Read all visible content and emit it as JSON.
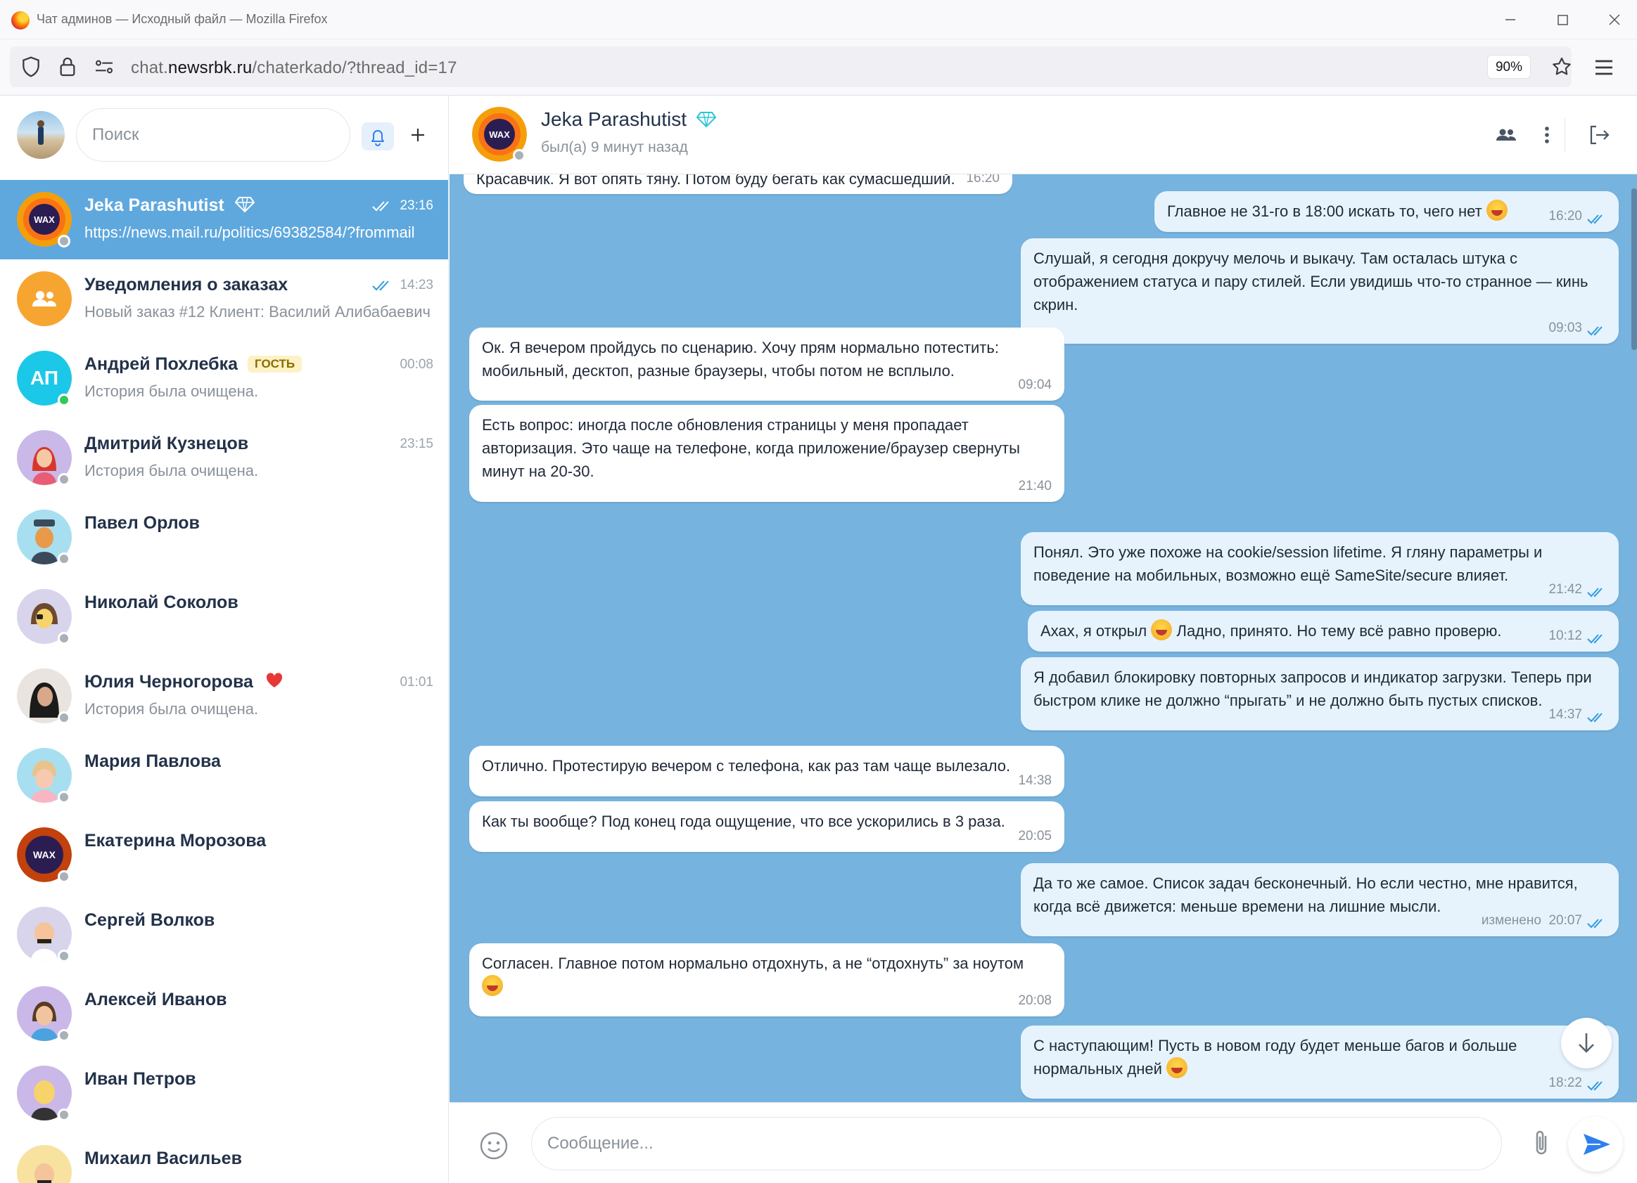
{
  "window": {
    "title": "Чат админов — Исходный файл — Mozilla Firefox"
  },
  "browser": {
    "url_host": "chat.newsrbk.ru",
    "url_path": "/chaterkado/?thread_id=17",
    "url_prefix": "chat.",
    "url_domain": "newsrbk.ru",
    "zoom": "90%"
  },
  "sidebar": {
    "search_placeholder": "Поиск",
    "chats": [
      {
        "name": "Jeka Parashutist",
        "preview": "https://news.mail.ru/politics/69382584/?frommail",
        "time": "23:16",
        "read": true,
        "active": true,
        "badge": "diamond",
        "avatar": "wax-logo-icon"
      },
      {
        "name": "Уведомления о заказах",
        "preview": "Новый заказ #12 Клиент: Василий Алибабаевич",
        "time": "14:23",
        "read": true,
        "avatar": "group-icon"
      },
      {
        "name": "Андрей Похлебка",
        "tag": "ГОСТЬ",
        "preview": "История была очищена.",
        "time": "00:08",
        "avatar_text": "АП",
        "online": true
      },
      {
        "name": "Дмитрий Кузнецов",
        "preview": "История была очищена.",
        "time": "23:15"
      },
      {
        "name": "Павел Орлов",
        "preview": "",
        "time": ""
      },
      {
        "name": "Николай Соколов",
        "preview": "",
        "time": ""
      },
      {
        "name": "Юлия Черногорова",
        "preview": "История была очищена.",
        "time": "01:01",
        "badge": "heart"
      },
      {
        "name": "Мария Павлова",
        "preview": "",
        "time": ""
      },
      {
        "name": "Екатерина Морозова",
        "preview": "",
        "time": ""
      },
      {
        "name": "Сергей Волков",
        "preview": "",
        "time": ""
      },
      {
        "name": "Алексей Иванов",
        "preview": "",
        "time": ""
      },
      {
        "name": "Иван Петров",
        "preview": "",
        "time": ""
      },
      {
        "name": "Михаил Васильев",
        "preview": "",
        "time": ""
      }
    ]
  },
  "chat": {
    "name": "Jeka Parashutist",
    "status": "был(а) 9 минут назад",
    "composer_placeholder": "Сообщение...",
    "messages": [
      {
        "dir": "in",
        "text": "Красавчик. Я вот опять тяну. Потом буду бегать как сумасшедший.",
        "time": "16:20"
      },
      {
        "dir": "out",
        "text": "Главное не 31-го в 18:00 искать то, чего нет",
        "emoji": true,
        "time": "16:20"
      },
      {
        "dir": "out",
        "text": "Слушай, я сегодня докручу мелочь и выкачу. Там осталась штука с отображением статуса и пару стилей. Если увидишь что-то странное — кинь скрин.",
        "time": "09:03"
      },
      {
        "dir": "in",
        "text": "Ок. Я вечером пройдусь по сценарию. Хочу прям нормально потестить: мобильный, десктоп, разные браузеры, чтобы потом не всплыло.",
        "time": "09:04"
      },
      {
        "dir": "in",
        "text": "Есть вопрос: иногда после обновления страницы у меня пропадает авторизация. Это чаще на телефоне, когда приложение/браузер свернуты минут на 20-30.",
        "time": "21:40"
      },
      {
        "dir": "out",
        "text": "Понял. Это уже похоже на cookie/session lifetime. Я гляну параметры и поведение на мобильных, возможно ещё SameSite/secure влияет.",
        "time": "21:42"
      },
      {
        "dir": "out",
        "text_a": "Ахах, я открыл",
        "text_b": "Ладно, принято. Но тему всё равно проверю.",
        "time": "10:12"
      },
      {
        "dir": "out",
        "text": "Я добавил блокировку повторных запросов и индикатор загрузки. Теперь при быстром клике не должно “прыгать” и не должно быть пустых списков.",
        "time": "14:37"
      },
      {
        "dir": "in",
        "text": "Отлично. Протестирую вечером с телефона, как раз там чаще вылезало.",
        "time": "14:38"
      },
      {
        "dir": "in",
        "text": "Как ты вообще? Под конец года ощущение, что все ускорились в 3 раза.",
        "time": "20:05"
      },
      {
        "dir": "out",
        "text": "Да то же самое. Список задач бесконечный. Но если честно, мне нравится, когда всё движется: меньше времени на лишние мысли.",
        "edited": "изменено",
        "time": "20:07"
      },
      {
        "dir": "in",
        "text": "Согласен. Главное потом нормально отдохнуть, а не “отдохнуть” за ноутом",
        "emoji": true,
        "time": "20:08"
      },
      {
        "dir": "out",
        "text": "С наступающим! Пусть в новом году будет меньше багов и больше нормальных дней",
        "emoji": true,
        "time": "18:22"
      }
    ]
  },
  "colors": {
    "accent": "#2f80ed",
    "active_chat": "#5fa8de",
    "chat_bg": "#76b3df",
    "out_bubble": "#e6f3fd",
    "in_bubble": "#ffffff",
    "check": "#2f9be0",
    "online": "#34c759"
  }
}
